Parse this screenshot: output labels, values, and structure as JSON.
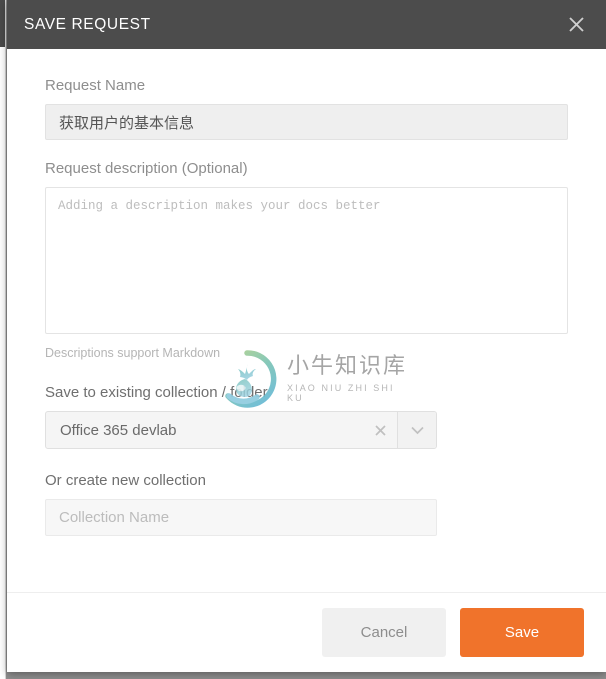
{
  "modal": {
    "title": "SAVE REQUEST",
    "close_icon": "close-icon"
  },
  "form": {
    "request_name": {
      "label": "Request Name",
      "value": "获取用户的基本信息",
      "placeholder": ""
    },
    "request_description": {
      "label": "Request description (Optional)",
      "value": "",
      "placeholder": "Adding a description makes your docs better",
      "hint": "Descriptions support Markdown"
    },
    "existing_collection": {
      "label": "Save to existing collection / folder",
      "value": "Office 365 devlab",
      "clear_icon": "close-icon",
      "dropdown_icon": "chevron-down-icon"
    },
    "new_collection": {
      "label": "Or create new collection",
      "value": "",
      "placeholder": "Collection Name"
    }
  },
  "footer": {
    "cancel_label": "Cancel",
    "save_label": "Save"
  },
  "watermark": {
    "chinese": "小牛知识库",
    "pinyin": "XIAO NIU ZHI SHI KU"
  },
  "colors": {
    "header_bg": "#4c4c4c",
    "save_accent": "#f0732b",
    "cancel_bg": "#f0f0f0",
    "input_bg": "#efefef",
    "label_text": "#8e8e8e"
  }
}
